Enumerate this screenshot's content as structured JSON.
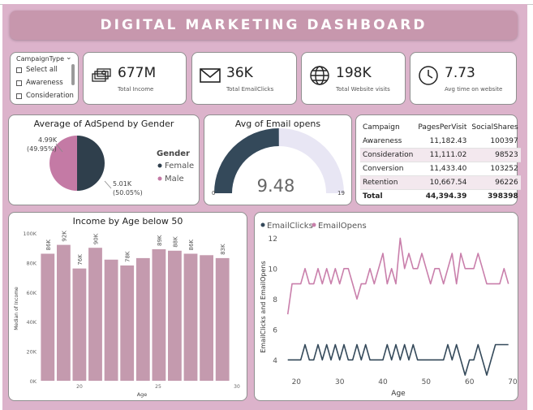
{
  "title": "DIGITAL MARKETING DASHBOARD",
  "slicer": {
    "title": "CampaignType",
    "items": [
      "Select all",
      "Awareness",
      "Consideration"
    ]
  },
  "kpis": [
    {
      "value": "677M",
      "label": "Total Income",
      "icon": "money-stack-icon"
    },
    {
      "value": "36K",
      "label": "Total EmailClicks",
      "icon": "envelope-icon"
    },
    {
      "value": "198K",
      "label": "Total Website visits",
      "icon": "globe-icon"
    },
    {
      "value": "7.73",
      "label": "Avg time on website",
      "icon": "clock-icon"
    }
  ],
  "pie": {
    "title": "Average of AdSpend by Gender",
    "legend_title": "Gender",
    "female_label": "4.99K",
    "female_pct": "(49.95%)",
    "male_label": "5.01K",
    "male_pct": "(50.05%)",
    "legend": [
      "Female",
      "Male"
    ]
  },
  "gauge": {
    "title": "Avg of Email opens",
    "value_text": "9.48",
    "min_text": "0",
    "max_text": "19"
  },
  "table": {
    "headers": [
      "Campaign",
      "PagesPerVisit",
      "SocialShares"
    ],
    "rows": [
      [
        "Awareness",
        "11,182.43",
        "100397"
      ],
      [
        "Consideration",
        "11,111.02",
        "98523"
      ],
      [
        "Conversion",
        "11,433.40",
        "103252"
      ],
      [
        "Retention",
        "10,667.54",
        "96226"
      ]
    ],
    "total": [
      "Total",
      "44,394.39",
      "398398"
    ]
  },
  "bar_title": "Income by Age below 50",
  "line_title_series": [
    "EmailClicks",
    "EmailOpens"
  ],
  "colors": {
    "background": "#dcb3cb",
    "title_bar": "#c797ad",
    "bar": "#c49aae",
    "female": "#c47aa5",
    "male": "#2f3f4c",
    "gauge_fill": "#34495a",
    "gauge_track": "#e8e6f4",
    "email_opens": "#c97fab",
    "email_clicks": "#34495a"
  },
  "chart_data": [
    {
      "type": "pie",
      "title": "Average of AdSpend by Gender",
      "legend_title": "Gender",
      "labels": [
        "Female",
        "Male"
      ],
      "values": [
        4990,
        5010
      ],
      "percent": [
        49.95,
        50.05
      ]
    },
    {
      "type": "gauge",
      "title": "Avg of Email opens",
      "value": 9.48,
      "min": 0,
      "max": 19
    },
    {
      "type": "bar",
      "title": "Income by Age below 50",
      "xlabel": "Age",
      "ylabel": "Median of Income",
      "x": [
        18,
        19,
        20,
        21,
        22,
        23,
        24,
        25,
        26,
        27,
        28,
        29
      ],
      "values": [
        86000,
        92000,
        76000,
        90000,
        82000,
        78000,
        83000,
        89000,
        88000,
        86000,
        85000,
        83000
      ],
      "bar_labels": [
        "86K",
        "92K",
        "76K",
        "90K",
        "",
        "78K",
        "",
        "89K",
        "88K",
        "86K",
        "",
        "83K"
      ],
      "yticks": [
        "0K",
        "20K",
        "40K",
        "60K",
        "80K",
        "100K"
      ],
      "xticks": [
        "20",
        "25",
        "30"
      ],
      "ylim": [
        0,
        100000
      ]
    },
    {
      "type": "line",
      "xlabel": "Age",
      "ylabel": "EmailClicks and EmailOpens",
      "xticks": [
        "20",
        "30",
        "40",
        "50",
        "60",
        "70"
      ],
      "yticks": [
        "4",
        "6",
        "8",
        "10",
        "12"
      ],
      "xlim": [
        16,
        70
      ],
      "ylim": [
        3,
        12.5
      ],
      "x": [
        18,
        19,
        20,
        21,
        22,
        23,
        24,
        25,
        26,
        27,
        28,
        29,
        30,
        31,
        32,
        33,
        34,
        35,
        36,
        37,
        38,
        39,
        40,
        41,
        42,
        43,
        44,
        45,
        46,
        47,
        48,
        49,
        50,
        51,
        52,
        53,
        54,
        55,
        56,
        57,
        58,
        59,
        60,
        61,
        62,
        63,
        64,
        65,
        66,
        67,
        68,
        69
      ],
      "series": [
        {
          "name": "EmailClicks",
          "values": [
            4,
            4,
            4,
            4,
            5,
            4,
            4,
            5,
            4,
            5,
            4,
            5,
            4,
            5,
            4,
            4,
            5,
            4,
            5,
            4,
            4,
            4,
            4,
            5,
            4,
            5,
            4,
            5,
            4,
            5,
            4,
            4,
            4,
            4,
            4,
            4,
            4,
            5,
            4,
            5,
            4,
            3,
            4,
            4,
            5,
            4,
            3,
            4,
            5,
            5,
            5,
            5,
            5,
            5,
            4,
            5,
            4
          ]
        },
        {
          "name": "EmailOpens",
          "values": [
            7,
            9,
            9,
            9,
            10,
            9,
            9,
            10,
            9,
            10,
            9,
            10,
            9,
            10,
            10,
            9,
            8,
            9,
            9,
            10,
            9,
            10,
            11,
            9,
            10,
            9,
            12,
            10,
            11,
            10,
            10,
            11,
            10,
            9,
            10,
            10,
            9,
            10,
            11,
            9,
            11,
            10,
            10,
            10,
            11,
            10,
            9,
            9,
            9,
            9,
            10,
            9,
            9,
            10,
            11,
            9,
            9,
            9
          ]
        }
      ]
    }
  ]
}
